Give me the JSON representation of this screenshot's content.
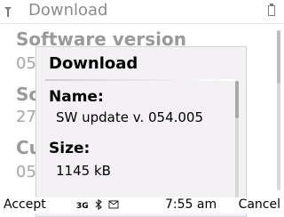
{
  "app": {
    "title": "Download"
  },
  "background": {
    "items": [
      {
        "title": "Software version",
        "value": "05"
      },
      {
        "title": "So",
        "value": "27"
      },
      {
        "title": "Cu",
        "value": "05"
      }
    ]
  },
  "dialog": {
    "heading": "Download",
    "fields": [
      {
        "label": "Name:",
        "value": "SW update v. 054.005"
      },
      {
        "label": "Size:",
        "value": "1145 kB"
      }
    ]
  },
  "softkeys": {
    "left": "Accept",
    "right": "Cancel"
  },
  "status": {
    "time": "7:55 am",
    "icons": [
      "3g-icon",
      "bluetooth-icon",
      "message-icon"
    ]
  }
}
